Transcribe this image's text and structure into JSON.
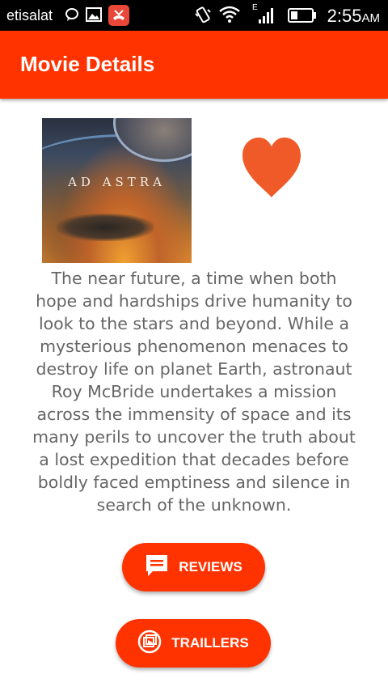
{
  "status_bar": {
    "carrier": "etisalat",
    "time": "2:55",
    "ampm": "AM",
    "network_label": "E"
  },
  "app_bar": {
    "title": "Movie Details",
    "color": "#ff3300"
  },
  "movie": {
    "poster_title": "AD ASTRA",
    "overview": "The near future, a time when both hope and hardships drive humanity to look to the stars and beyond. While a mysterious phenomenon menaces to destroy life on planet Earth, astronaut Roy McBride undertakes a mission across the immensity of space and its many perils to uncover the truth about a lost expedition that decades before boldly faced emptiness and silence in search of the unknown.",
    "favorite_icon": "heart-icon",
    "favorite_color": "#f05a28"
  },
  "buttons": {
    "reviews_label": "REVIEWS",
    "reviews_icon": "comment-icon",
    "trailers_label": "TRAILLERS",
    "trailers_icon": "play-video-icon"
  }
}
